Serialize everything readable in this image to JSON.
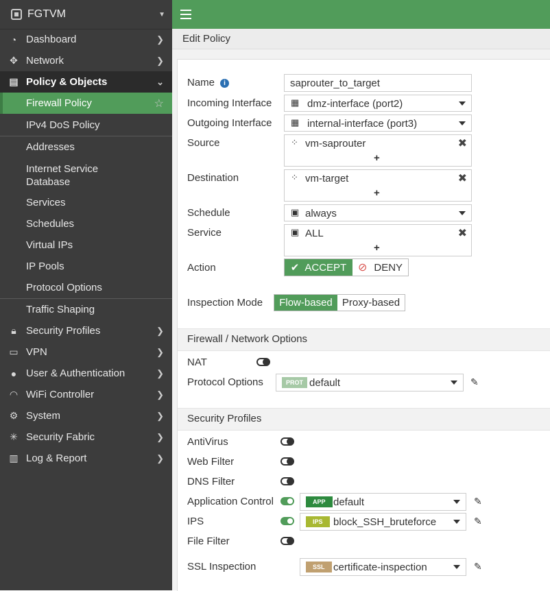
{
  "app": {
    "device_name": "FGTVM"
  },
  "sidebar": {
    "items": [
      {
        "label": "Dashboard"
      },
      {
        "label": "Network"
      },
      {
        "label": "Policy & Objects"
      },
      {
        "label": "Firewall Policy"
      },
      {
        "label": "IPv4 DoS Policy"
      },
      {
        "label": "Addresses"
      },
      {
        "label": "Internet Service Database"
      },
      {
        "label": "Services"
      },
      {
        "label": "Schedules"
      },
      {
        "label": "Virtual IPs"
      },
      {
        "label": "IP Pools"
      },
      {
        "label": "Protocol Options"
      },
      {
        "label": "Traffic Shaping"
      },
      {
        "label": "Security Profiles"
      },
      {
        "label": "VPN"
      },
      {
        "label": "User & Authentication"
      },
      {
        "label": "WiFi Controller"
      },
      {
        "label": "System"
      },
      {
        "label": "Security Fabric"
      },
      {
        "label": "Log & Report"
      }
    ],
    "internet_service_line1": "Internet Service",
    "internet_service_line2": "Database"
  },
  "header": {
    "page_title": "Edit Policy"
  },
  "form": {
    "name_label": "Name",
    "name_value": "saprouter_to_target",
    "incoming_label": "Incoming Interface",
    "incoming_value": "dmz-interface (port2)",
    "outgoing_label": "Outgoing Interface",
    "outgoing_value": "internal-interface (port3)",
    "source_label": "Source",
    "source_value": "vm-saprouter",
    "destination_label": "Destination",
    "destination_value": "vm-target",
    "schedule_label": "Schedule",
    "schedule_value": "always",
    "service_label": "Service",
    "service_value": "ALL",
    "action_label": "Action",
    "action_accept": "ACCEPT",
    "action_deny": "DENY",
    "inspection_label": "Inspection Mode",
    "inspection_flow": "Flow-based",
    "inspection_proxy": "Proxy-based",
    "plus": "+"
  },
  "firewall_options": {
    "section_title": "Firewall / Network Options",
    "nat_label": "NAT",
    "nat_enabled": false,
    "protocol_options_label": "Protocol Options",
    "protocol_badge": "PROT",
    "protocol_value": "default"
  },
  "security_profiles": {
    "section_title": "Security Profiles",
    "antivirus_label": "AntiVirus",
    "antivirus_enabled": false,
    "webfilter_label": "Web Filter",
    "webfilter_enabled": false,
    "dnsfilter_label": "DNS Filter",
    "dnsfilter_enabled": false,
    "appcontrol_label": "Application Control",
    "appcontrol_enabled": true,
    "appcontrol_badge": "APP",
    "appcontrol_value": "default",
    "ips_label": "IPS",
    "ips_enabled": true,
    "ips_badge": "IPS",
    "ips_value": "block_SSH_bruteforce",
    "filefilter_label": "File Filter",
    "filefilter_enabled": false,
    "ssl_label": "SSL Inspection",
    "ssl_badge": "SSL",
    "ssl_value": "certificate-inspection"
  },
  "colors": {
    "accent": "#519c5a",
    "sidebar_bg": "#3c3c3c",
    "app_badge": "#2d8a3e",
    "ips_badge": "#a8b832",
    "ssl_badge": "#c0a070",
    "prot_badge": "#a6c9a6",
    "deny": "#d9534f"
  }
}
